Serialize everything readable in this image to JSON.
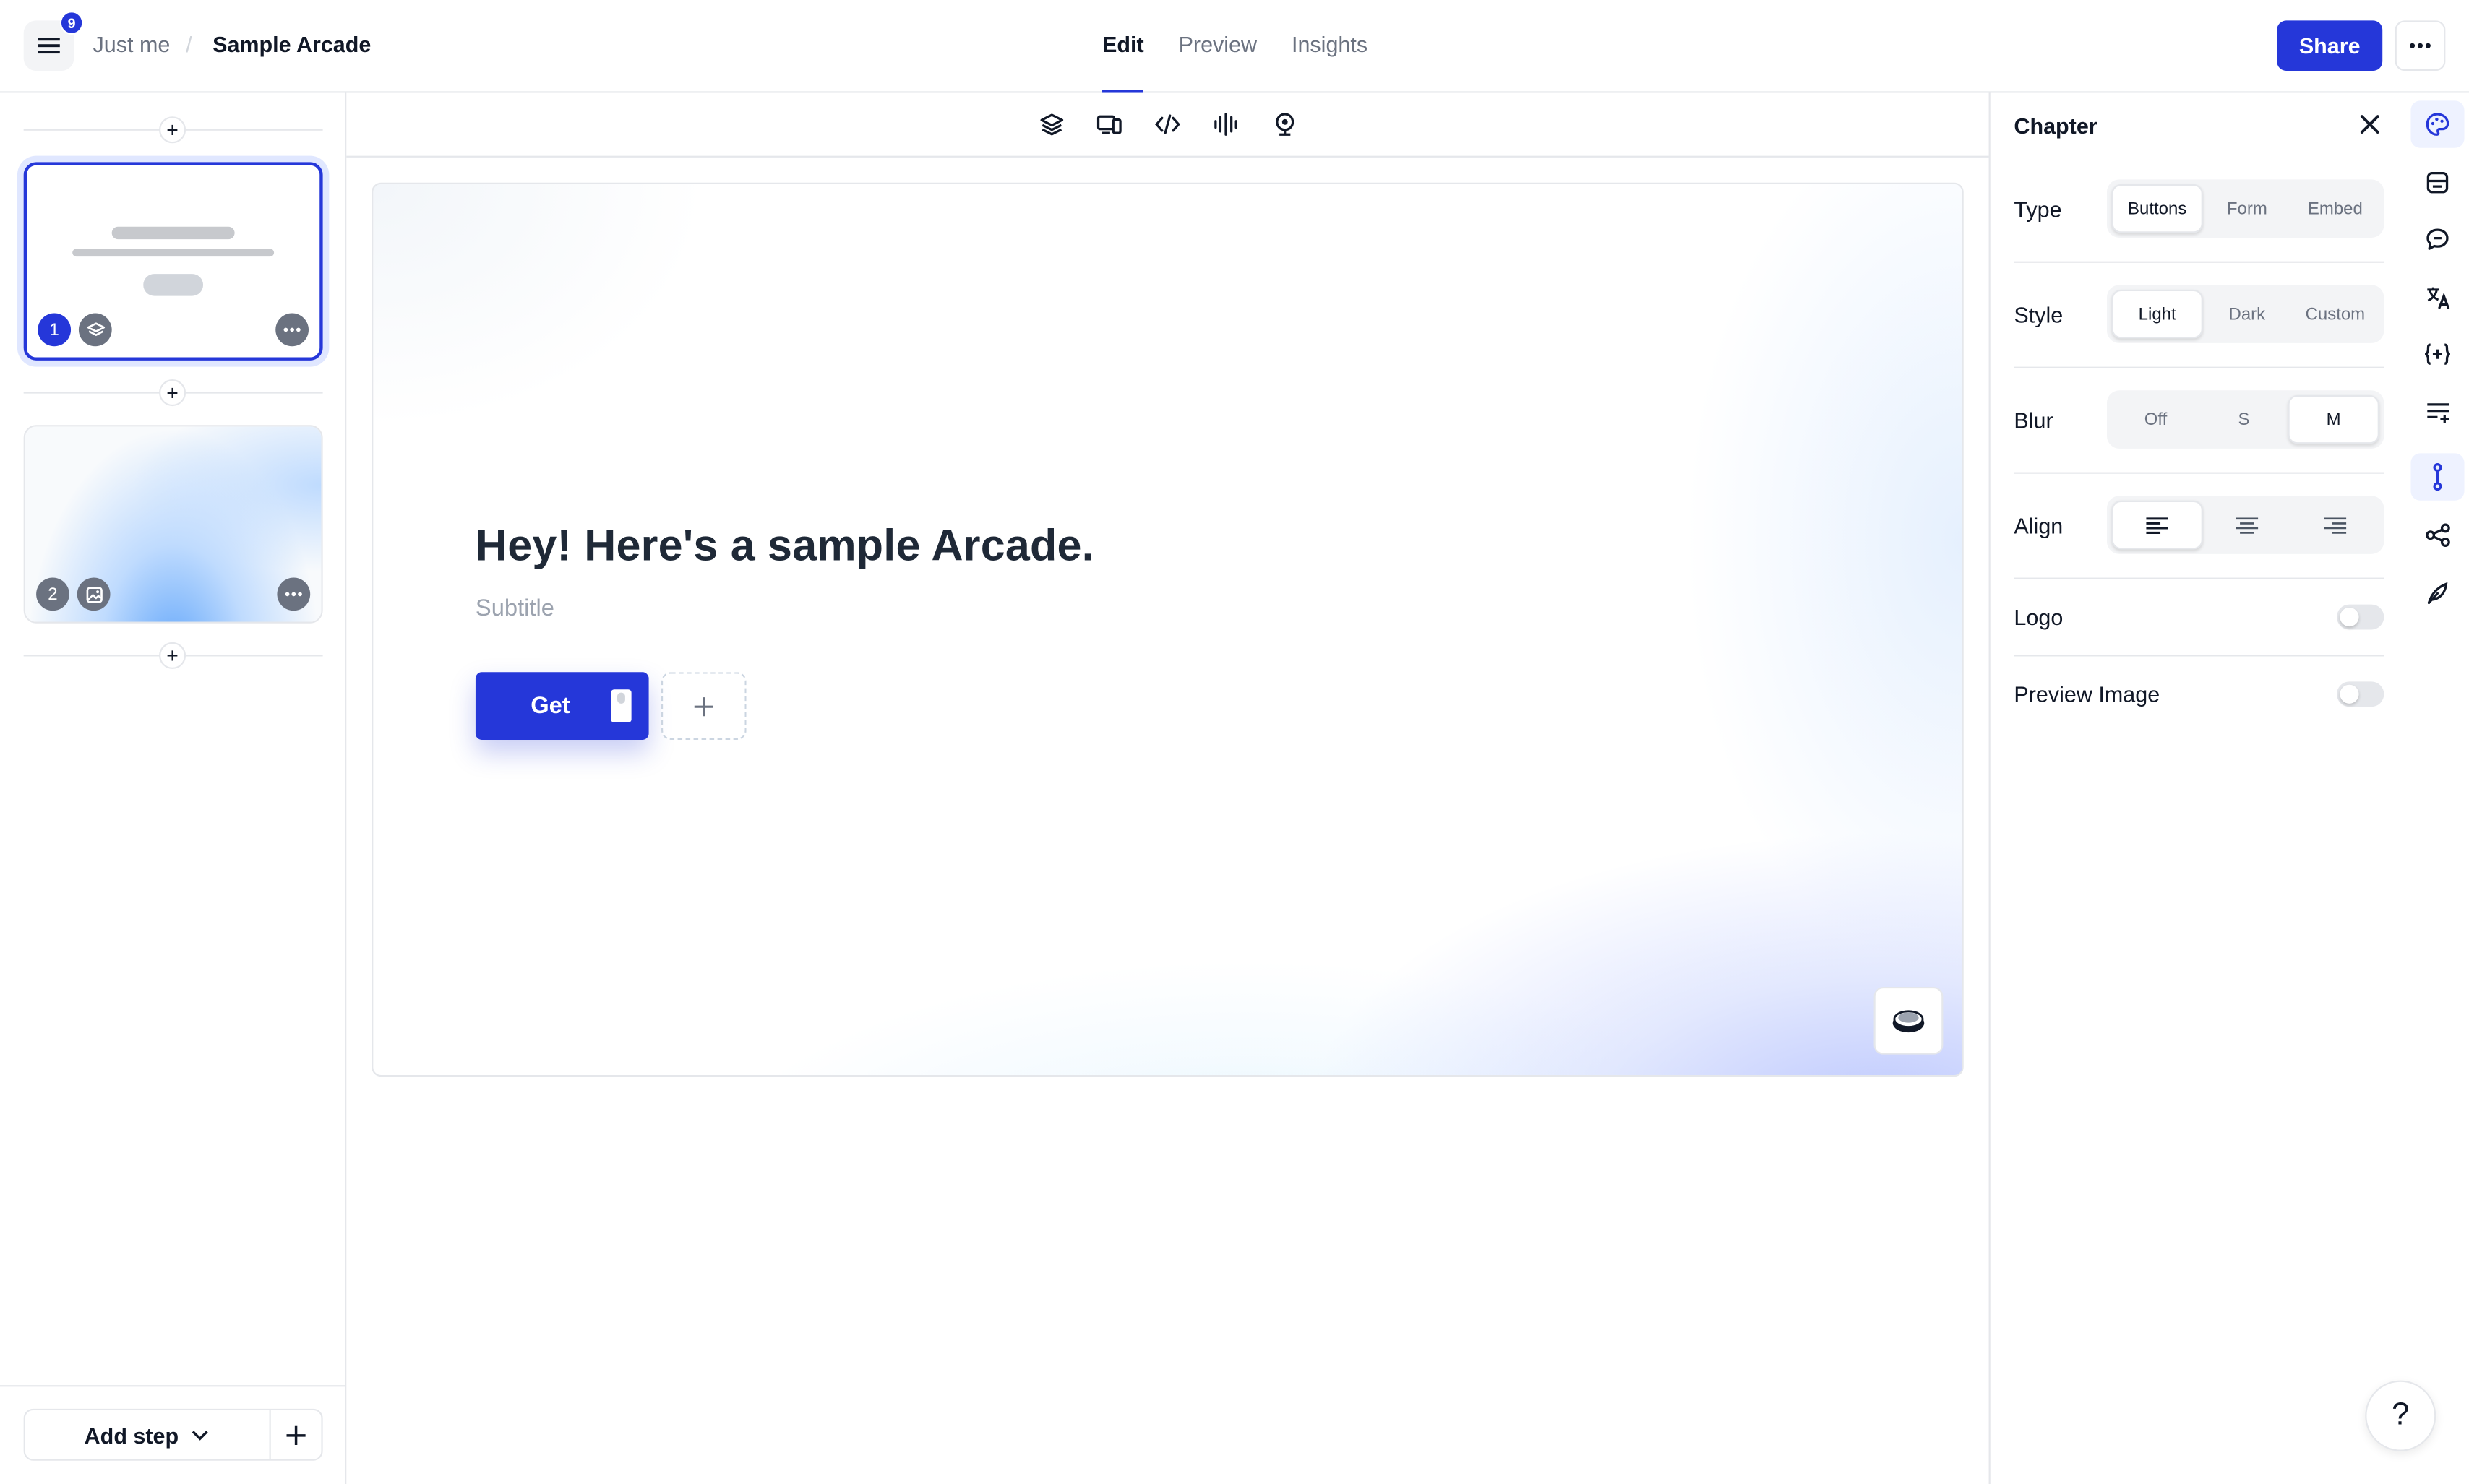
{
  "header": {
    "notification_count": "9",
    "breadcrumb_owner": "Just me",
    "breadcrumb_separator": "/",
    "title": "Sample Arcade",
    "tabs": [
      {
        "label": "Edit",
        "active": true
      },
      {
        "label": "Preview",
        "active": false
      },
      {
        "label": "Insights",
        "active": false
      }
    ],
    "share_label": "Share"
  },
  "sidebar": {
    "steps": [
      {
        "number": "1",
        "type_icon": "layers-icon",
        "selected": true
      },
      {
        "number": "2",
        "type_icon": "image-icon",
        "selected": false
      }
    ],
    "add_step_label": "Add step"
  },
  "toolbar": {
    "icons": [
      "layers-icon",
      "device-icon",
      "code-icon",
      "audio-wave-icon",
      "webcam-icon"
    ]
  },
  "canvas": {
    "title": "Hey! Here's a sample Arcade.",
    "subtitle": "Subtitle",
    "button_label": "Get"
  },
  "panel": {
    "title": "Chapter",
    "type": {
      "label": "Type",
      "options": [
        "Buttons",
        "Form",
        "Embed"
      ],
      "selected": "Buttons"
    },
    "style": {
      "label": "Style",
      "options": [
        "Light",
        "Dark",
        "Custom"
      ],
      "selected": "Light"
    },
    "blur": {
      "label": "Blur",
      "options": [
        "Off",
        "S",
        "M"
      ],
      "selected": "M"
    },
    "align": {
      "label": "Align",
      "options": [
        "left",
        "center",
        "right"
      ],
      "selected": "left"
    },
    "logo": {
      "label": "Logo",
      "enabled": false
    },
    "preview_image": {
      "label": "Preview Image",
      "enabled": false
    }
  },
  "rail": {
    "icons": [
      "palette-icon",
      "layout-icon",
      "comment-icon",
      "translate-icon",
      "variables-icon",
      "list-add-icon",
      "path-icon",
      "share-nodes-icon",
      "feather-icon"
    ],
    "active": "path-icon"
  },
  "help_label": "?",
  "colors": {
    "accent": "#2537d9",
    "border": "#e5e7eb",
    "muted_text": "#6b7280"
  }
}
